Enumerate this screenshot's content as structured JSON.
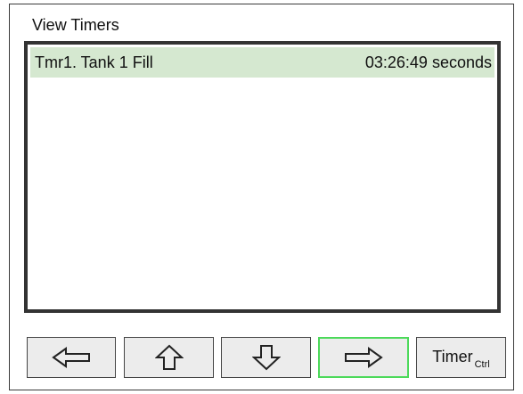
{
  "header": {
    "title": "View Timers"
  },
  "timers": [
    {
      "name": "Tmr1. Tank 1 Fill",
      "value": "03:26:49 seconds",
      "selected": true
    }
  ],
  "colors": {
    "selected_row": "#d5e8d0",
    "active_button_border": "#4cd95a",
    "panel_border": "#333333",
    "button_bg": "#ececec"
  },
  "buttons": {
    "left_icon": "arrow-left-icon",
    "up_icon": "arrow-up-icon",
    "down_icon": "arrow-down-icon",
    "right_icon": "arrow-right-icon",
    "timer_label": "Timer",
    "timer_sub": "Ctrl",
    "active": "right"
  }
}
